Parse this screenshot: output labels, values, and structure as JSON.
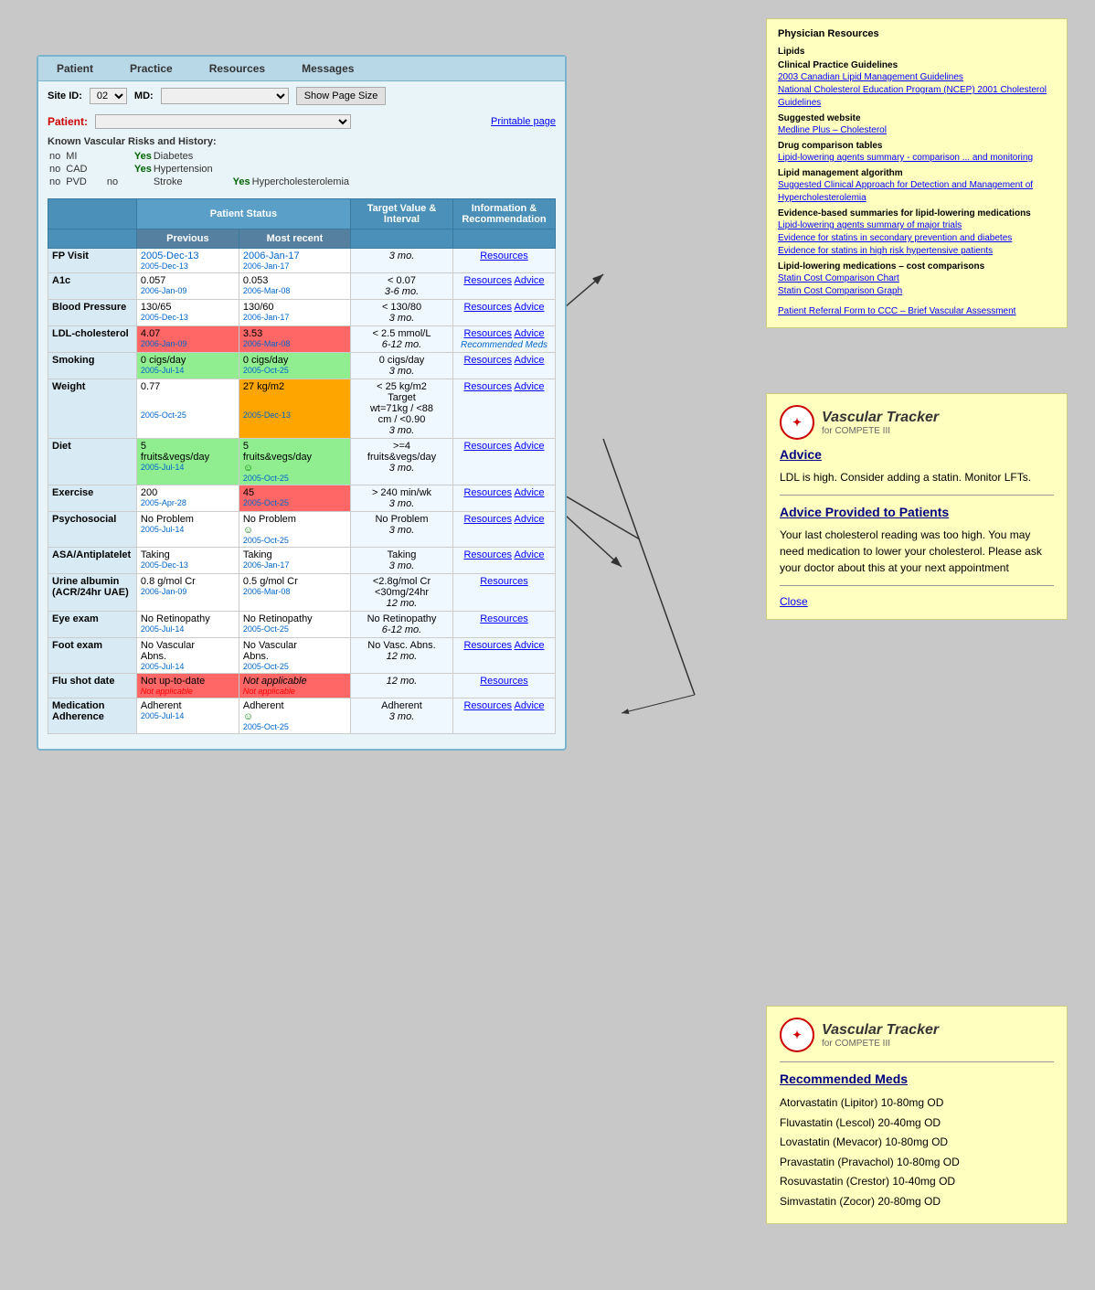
{
  "nav": {
    "items": [
      "Patient",
      "Practice",
      "Resources",
      "Messages"
    ]
  },
  "toolbar": {
    "site_id_label": "Site ID:",
    "site_id_value": "02",
    "md_label": "MD:",
    "show_page_btn": "Show Page Size",
    "patient_label": "Patient:",
    "printable_link": "Printable page"
  },
  "vascular_risks": {
    "label": "Known Vascular Risks and History:",
    "risks": [
      {
        "label": "no",
        "value": "MI"
      },
      {
        "label": "Yes",
        "value": "Diabetes"
      },
      {
        "label": "no",
        "value": "CAD"
      },
      {
        "label": "Yes",
        "value": "Hypertension"
      },
      {
        "label": "no",
        "value": "PVD"
      },
      {
        "label": "no",
        "value": "Stroke"
      },
      {
        "label": "Yes",
        "value": "Hypercholesterolemia"
      }
    ]
  },
  "table": {
    "headers": {
      "category": "",
      "patient_status": "Patient Status",
      "previous": "Previous",
      "most_recent": "Most recent",
      "target": "Target Value & Interval",
      "info": "Information & Recommendation"
    },
    "rows": [
      {
        "label": "FP Visit",
        "previous": "2005-Dec-13",
        "previous_date": "2005-Dec-13",
        "most_recent": "2006-Jan-17",
        "most_recent_date": "2006-Jan-17",
        "target": "3 mo.",
        "resources": "Resources",
        "advice": "",
        "row_style": "normal"
      },
      {
        "label": "A1c",
        "previous": "0.057",
        "previous_date": "2006-Jan-09",
        "most_recent": "0.053",
        "most_recent_date": "2006-Mar-08",
        "target": "< 0.07",
        "target_interval": "3-6 mo.",
        "resources": "Resources",
        "advice": "Advice",
        "row_style": "normal"
      },
      {
        "label": "Blood Pressure",
        "previous": "130/65",
        "previous_date": "2005-Dec-13",
        "most_recent": "130/60",
        "most_recent_date": "2006-Jan-17",
        "target": "< 130/80",
        "target_interval": "3 mo.",
        "resources": "Resources",
        "advice": "Advice",
        "row_style": "normal"
      },
      {
        "label": "LDL-cholesterol",
        "previous": "4.07",
        "previous_date": "2006-Jan-09",
        "most_recent": "3.53",
        "most_recent_date": "2006-Mar-08",
        "target": "< 2.5 mmol/L",
        "target_interval": "6-12 mo.",
        "resources": "Resources",
        "advice": "Advice",
        "extra": "Recommended Meds",
        "row_style": "red"
      },
      {
        "label": "Smoking",
        "previous": "0 cigs/day",
        "previous_date": "2005-Jul-14",
        "most_recent": "0 cigs/day",
        "most_recent_date": "2005-Oct-25",
        "target": "0 cigs/day",
        "target_interval": "3 mo.",
        "resources": "Resources",
        "advice": "Advice",
        "row_style": "green"
      },
      {
        "label": "Weight",
        "previous": "0.77",
        "previous_date": "2005-Oct-25",
        "most_recent": "27 kg/m2",
        "most_recent_date": "2005-Dec-13",
        "target": "< 25 kg/m2 Target wt=71kg / <88 cm / <0.90",
        "target_interval": "3 mo.",
        "resources": "Resources",
        "advice": "Advice",
        "row_style": "orange_recent"
      },
      {
        "label": "Diet",
        "previous": "5 fruits&vegs/day",
        "previous_date": "2005-Jul-14",
        "most_recent": "5 fruits&vegs/day",
        "most_recent_date": "2005-Oct-25",
        "most_recent_check": true,
        "target": ">=4 fruits&vegs/day",
        "target_interval": "3 mo.",
        "resources": "Resources",
        "advice": "Advice",
        "row_style": "green"
      },
      {
        "label": "Exercise",
        "previous": "200",
        "previous_date": "2005-Apr-28",
        "most_recent": "45",
        "most_recent_date": "2005-Oct-25",
        "target": "> 240 min/wk",
        "target_interval": "3 mo.",
        "resources": "Resources",
        "advice": "Advice",
        "row_style": "red_recent"
      },
      {
        "label": "Psychosocial",
        "previous": "No Problem",
        "previous_date": "2005-Jul-14",
        "most_recent": "No Problem",
        "most_recent_date": "2005-Oct-25",
        "most_recent_check": true,
        "target": "No Problem",
        "target_interval": "3 mo.",
        "resources": "Resources",
        "advice": "Advice",
        "row_style": "normal"
      },
      {
        "label": "ASA/Antiplatelet",
        "previous": "Taking",
        "previous_date": "2005-Dec-13",
        "most_recent": "Taking",
        "most_recent_date": "2006-Jan-17",
        "target": "Taking",
        "target_interval": "3 mo.",
        "resources": "Resources",
        "advice": "Advice",
        "row_style": "normal"
      },
      {
        "label": "Urine albumin (ACR/24hr UAE)",
        "previous": "0.8 g/mol Cr",
        "previous_date": "2006-Jan-09",
        "most_recent": "0.5 g/mol Cr",
        "most_recent_date": "2006-Mar-08",
        "target": "<2.8g/mol Cr <30mg/24hr",
        "target_interval": "12 mo.",
        "resources": "Resources",
        "advice": "",
        "row_style": "normal"
      },
      {
        "label": "Eye exam",
        "previous": "No Retinopathy",
        "previous_date": "2005-Jul-14",
        "most_recent": "No Retinopathy",
        "most_recent_date": "2005-Oct-25",
        "target": "No Retinopathy",
        "target_interval": "6-12 mo.",
        "resources": "Resources",
        "advice": "",
        "row_style": "normal"
      },
      {
        "label": "Foot exam",
        "previous": "No Vascular Abns.",
        "previous_date": "2005-Jul-14",
        "most_recent": "No Vascular Abns.",
        "most_recent_date": "2005-Oct-25",
        "target": "No Vasc. Abns.",
        "target_interval": "12 mo.",
        "resources": "Resources",
        "advice": "Advice",
        "row_style": "normal"
      },
      {
        "label": "Flu shot date",
        "previous": "Not up-to-date",
        "previous_date": "",
        "most_recent": "Not applicable",
        "most_recent_date": "",
        "target": "",
        "target_interval": "12 mo.",
        "resources": "Resources",
        "advice": "",
        "row_style": "red_both"
      },
      {
        "label": "Medication Adherence",
        "previous": "Adherent",
        "previous_date": "2005-Jul-14",
        "most_recent": "Adherent",
        "most_recent_date": "2005-Oct-25",
        "most_recent_check": true,
        "target": "Adherent",
        "target_interval": "3 mo.",
        "resources": "Resources",
        "advice": "Advice",
        "row_style": "normal"
      }
    ]
  },
  "physician_resources": {
    "title": "Physician Resources",
    "sections": [
      {
        "title": "Lipids",
        "items": [
          {
            "subtitle": "Clinical Practice Guidelines",
            "links": [
              "2003 Canadian Lipid Management Guidelines",
              "National Cholesterol Education Program (NCEP) 2001 Cholesterol Guidelines"
            ]
          },
          {
            "subtitle": "Suggested website",
            "links": [
              "Medline Plus – Cholesterol"
            ]
          },
          {
            "subtitle": "Drug comparison tables",
            "links": [
              "Lipid-lowering agents summary - comparison ... and monitoring"
            ]
          },
          {
            "subtitle": "Lipid management algorithm",
            "links": [
              "Suggested Clinical Approach for Detection and Management of Hypercholesterolemia"
            ]
          },
          {
            "subtitle": "Evidence-based summaries for lipid-lowering medications",
            "links": [
              "Lipid-lowering agents summary of major trials",
              "Evidence for statins in secondary prevention and diabetes",
              "Evidence for statins in high risk hypertensive patients"
            ]
          },
          {
            "subtitle": "Lipid-lowering medications – cost comparisons",
            "links": [
              "Statin Cost Comparison Chart",
              "Statin Cost Comparison Graph"
            ]
          },
          {
            "subtitle": "",
            "links": [
              "Patient Referral Form to CCC – Brief Vascular Assessment"
            ]
          }
        ]
      }
    ]
  },
  "advice_popup": {
    "compete_label": "COMPETE",
    "tracker_title": "Vascular Tracker",
    "tracker_sub": "for COMPETE III",
    "advice_title": "Advice",
    "advice_text": "LDL is high. Consider adding a statin. Monitor LFTs.",
    "advice_to_patients_title": "Advice Provided to Patients",
    "advice_to_patients_text": "Your last cholesterol reading was too high. You may need medication to lower your cholesterol. Please ask your doctor about this at your next appointment",
    "close_label": "Close"
  },
  "meds_popup": {
    "compete_label": "COMPETE",
    "tracker_title": "Vascular Tracker",
    "tracker_sub": "for COMPETE III",
    "meds_title": "Recommended Meds",
    "medications": [
      "Atorvastatin (Lipitor) 10-80mg OD",
      "Fluvastatin (Lescol) 20-40mg OD",
      "Lovastatin (Mevacor) 10-80mg OD",
      "Pravastatin (Pravachol) 10-80mg OD",
      "Rosuvastatin (Crestor) 10-40mg OD",
      "Simvastatin (Zocor) 20-80mg OD"
    ]
  }
}
